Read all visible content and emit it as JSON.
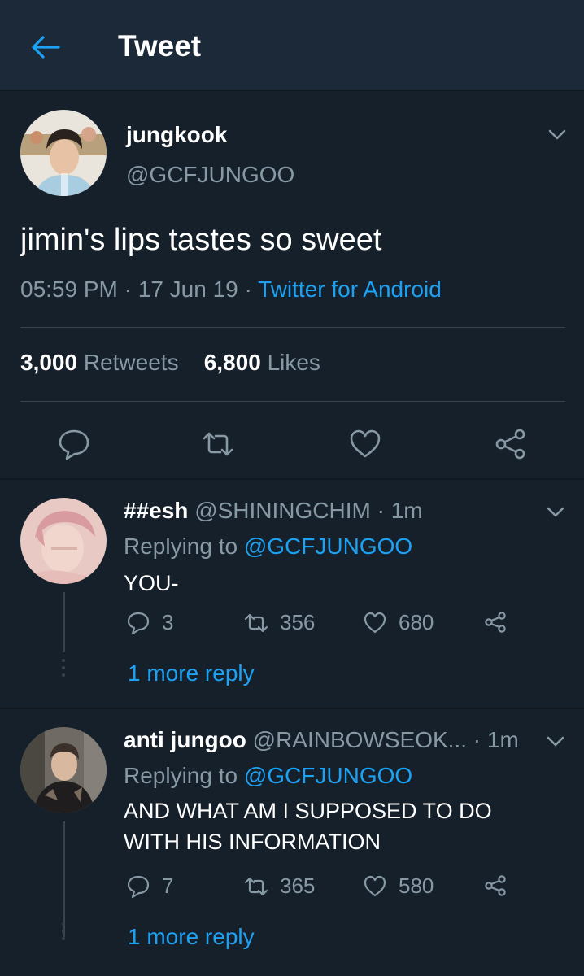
{
  "header": {
    "title": "Tweet",
    "back_icon": "arrow-left-icon"
  },
  "tweet": {
    "author_name": "jungkook",
    "author_handle": "@GCFJUNGOO",
    "text": "jimin's lips tastes so sweet",
    "time": "05:59 PM",
    "date": "17 Jun 19",
    "source": "Twitter for Android",
    "retweets_count": "3,000",
    "retweets_label": "Retweets",
    "likes_count": "6,800",
    "likes_label": "Likes"
  },
  "replies": [
    {
      "name": "##esh",
      "handle": "@SHININGCHIM",
      "time": "1m",
      "replying_label": "Replying to",
      "replying_to": "@GCFJUNGOO",
      "text_lines": [
        "YOU-"
      ],
      "reply_count": "3",
      "retweet_count": "356",
      "like_count": "680",
      "more_replies": "1 more reply"
    },
    {
      "name": "anti jungoo",
      "handle": "@RAINBOWSEOK...",
      "time": "1m",
      "replying_label": "Replying to",
      "replying_to": "@GCFJUNGOO",
      "text_lines": [
        "AND WHAT AM I SUPPOSED TO DO",
        "WITH HIS INFORMATION"
      ],
      "reply_count": "7",
      "retweet_count": "365",
      "like_count": "580",
      "more_replies": "1 more reply"
    }
  ],
  "colors": {
    "background": "#15202b",
    "header": "#1c2938",
    "accent": "#1da1f2",
    "muted": "#8899a6"
  }
}
